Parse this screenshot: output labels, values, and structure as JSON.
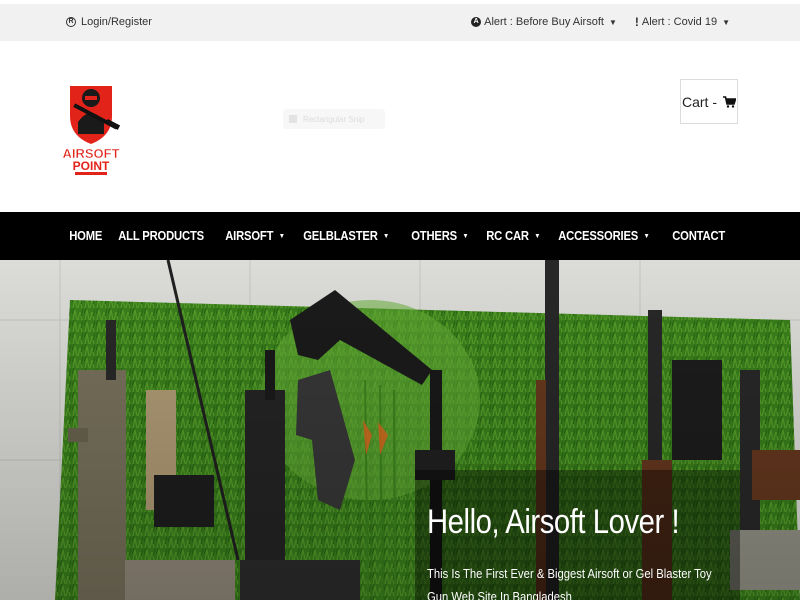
{
  "topbar": {
    "login_label": "Login/Register",
    "alerts": [
      {
        "label": "Alert : Before Buy Airsoft",
        "icon": "circle-a-icon"
      },
      {
        "label": "Alert : Covid 19",
        "icon": "exclamation-icon"
      }
    ]
  },
  "header": {
    "logo_text_line1": "AIRSOFT",
    "logo_text_line2": "POINT",
    "search_placeholder": "Rectangular Snip",
    "cart_label": "Cart -"
  },
  "nav": {
    "items": [
      "HOME",
      "ALL PRODUCTS",
      "AIRSOFT",
      "GELBLASTER",
      "OTHERS",
      "RC CAR",
      "ACCESSORIES",
      "CONTACT"
    ]
  },
  "hero": {
    "title": "Hello, Airsoft Lover !",
    "subtitle": "This Is The First Ever & Biggest Airsoft or Gel Blaster Toy Gun Web Site In Bangladesh"
  },
  "colors": {
    "nav_bg": "#000000",
    "topbar_bg": "#f1f1f1",
    "grass": "#3f8a1f",
    "logo_red": "#e2231a"
  }
}
